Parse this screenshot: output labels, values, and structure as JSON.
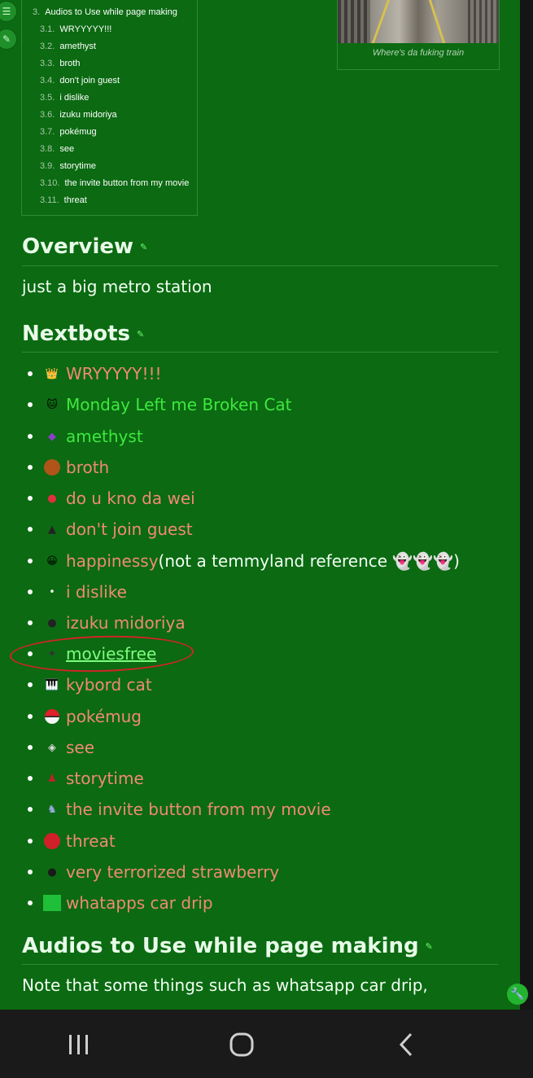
{
  "toc": {
    "items": [
      {
        "num": "3.",
        "label": "Audios to Use while page making"
      },
      {
        "num": "3.1.",
        "label": "WRYYYYY!!!"
      },
      {
        "num": "3.2.",
        "label": "amethyst"
      },
      {
        "num": "3.3.",
        "label": "broth"
      },
      {
        "num": "3.4.",
        "label": "don't join guest"
      },
      {
        "num": "3.5.",
        "label": "i dislike"
      },
      {
        "num": "3.6.",
        "label": "izuku midoriya"
      },
      {
        "num": "3.7.",
        "label": "pokémug"
      },
      {
        "num": "3.8.",
        "label": "see"
      },
      {
        "num": "3.9.",
        "label": "storytime"
      },
      {
        "num": "3.10.",
        "label": "the invite button from my movie"
      },
      {
        "num": "3.11.",
        "label": "threat"
      }
    ]
  },
  "infobox": {
    "caption": "Where's da fuking train"
  },
  "overview": {
    "heading": "Overview",
    "text": "just a big metro station"
  },
  "nextbots": {
    "heading": "Nextbots",
    "items": [
      {
        "label": "WRYYYYY!!!",
        "icon": "dio-icon",
        "state": "normal",
        "suffix": ""
      },
      {
        "label": "Monday Left me Broken Cat",
        "icon": "cat-icon",
        "state": "visited",
        "suffix": ""
      },
      {
        "label": "amethyst",
        "icon": "amethyst-icon",
        "state": "visited",
        "suffix": ""
      },
      {
        "label": "broth",
        "icon": "broth-icon",
        "state": "normal",
        "suffix": ""
      },
      {
        "label": "do u kno da wei",
        "icon": "knuckles-icon",
        "state": "normal",
        "suffix": ""
      },
      {
        "label": "don't join guest",
        "icon": "guest-icon",
        "state": "normal",
        "suffix": ""
      },
      {
        "label": "happinessy",
        "icon": "smiley-icon",
        "state": "normal",
        "suffix": " (not a temmyland reference 👻👻👻)"
      },
      {
        "label": "i dislike",
        "icon": "dislike-icon",
        "state": "normal",
        "suffix": ""
      },
      {
        "label": "izuku midoriya",
        "icon": "izuku-icon",
        "state": "normal",
        "suffix": ""
      },
      {
        "label": "moviesfree",
        "icon": "moviesfree-icon",
        "state": "active",
        "suffix": ""
      },
      {
        "label": "kybord cat",
        "icon": "keyboard-cat-icon",
        "state": "normal",
        "suffix": ""
      },
      {
        "label": "pokémug",
        "icon": "pokeball-icon",
        "state": "normal",
        "suffix": ""
      },
      {
        "label": "see",
        "icon": "see-icon",
        "state": "normal",
        "suffix": ""
      },
      {
        "label": "storytime",
        "icon": "storytime-icon",
        "state": "normal",
        "suffix": ""
      },
      {
        "label": "the invite button from my movie",
        "icon": "invite-icon",
        "state": "normal",
        "suffix": ""
      },
      {
        "label": "threat",
        "icon": "threat-icon",
        "state": "normal",
        "suffix": ""
      },
      {
        "label": "very terrorized strawberry",
        "icon": "strawberry-icon",
        "state": "normal",
        "suffix": ""
      },
      {
        "label": "whatapps car drip",
        "icon": "car-icon",
        "state": "normal",
        "suffix": ""
      }
    ]
  },
  "audios": {
    "heading": "Audios to Use while page making",
    "text": "Note that some things such as whatsapp car drip,"
  },
  "colors": {
    "page_bg": "#0b6a12",
    "link": "#f08a73",
    "visited_link": "#3ee83e",
    "annotation": "#d0242a"
  }
}
